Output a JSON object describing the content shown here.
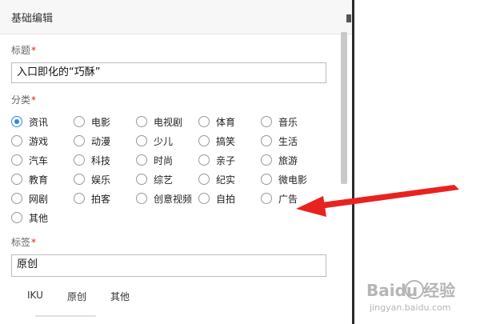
{
  "panel": {
    "header_title": "基础编辑",
    "title_label": "标题",
    "title_value": "入口即化的“巧酥”",
    "category_label": "分类",
    "tag_label": "标签",
    "tag_value": "原创",
    "required_mark": "*"
  },
  "categories": [
    [
      "资讯",
      "电影",
      "电视剧",
      "体育",
      "音乐"
    ],
    [
      "游戏",
      "动漫",
      "少儿",
      "搞笑",
      "生活"
    ],
    [
      "汽车",
      "科技",
      "时尚",
      "亲子",
      "旅游"
    ],
    [
      "教育",
      "娱乐",
      "综艺",
      "纪实",
      "微电影"
    ],
    [
      "网剧",
      "拍客",
      "创意视频",
      "自拍",
      "广告"
    ],
    [
      "其他"
    ]
  ],
  "selected_category": "资讯",
  "tag_suggestions": [
    "IKU",
    "原创",
    "其他"
  ],
  "watermark": {
    "brand": "Baidu 经验",
    "url": "jingyan.baidu.com"
  },
  "colors": {
    "accent": "#2b8ae2",
    "required": "#e02020",
    "arrow": "#e8231f"
  }
}
